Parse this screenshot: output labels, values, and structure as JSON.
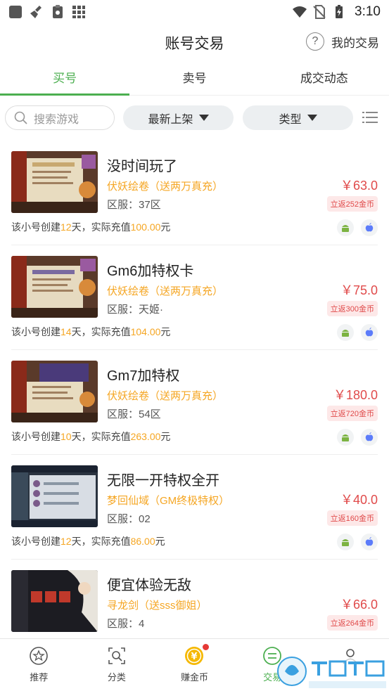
{
  "status_bar": {
    "time": "3:10"
  },
  "header": {
    "title": "账号交易",
    "my_trade": "我的交易"
  },
  "tabs": [
    {
      "label": "买号",
      "active": true
    },
    {
      "label": "卖号",
      "active": false
    },
    {
      "label": "成交动态",
      "active": false
    }
  ],
  "filters": {
    "search_placeholder": "搜索游戏",
    "latest_label": "最新上架",
    "type_label": "类型"
  },
  "listings": [
    {
      "title": "没时间玩了",
      "game": "伏妖绘卷（送两万真充）",
      "server": "区服：37区",
      "price": "￥63.0",
      "rebate": "立返252金币",
      "info_prefix": "该小号创建",
      "days": "12",
      "info_mid": "天，实际充值",
      "recharge": "100.00",
      "info_suffix": "元"
    },
    {
      "title": "Gm6加特权卡",
      "game": "伏妖绘卷（送两万真充）",
      "server": "区服：天姬·",
      "price": "￥75.0",
      "rebate": "立返300金币",
      "info_prefix": "该小号创建",
      "days": "14",
      "info_mid": "天，实际充值",
      "recharge": "104.00",
      "info_suffix": "元"
    },
    {
      "title": "Gm7加特权",
      "game": "伏妖绘卷（送两万真充）",
      "server": "区服：54区",
      "price": "￥180.0",
      "rebate": "立返720金币",
      "info_prefix": "该小号创建",
      "days": "10",
      "info_mid": "天，实际充值",
      "recharge": "263.00",
      "info_suffix": "元"
    },
    {
      "title": "无限一开特权全开",
      "game": "梦回仙域（GM终极特权）",
      "server": "区服：02",
      "price": "￥40.0",
      "rebate": "立返160金币",
      "info_prefix": "该小号创建",
      "days": "12",
      "info_mid": "天，实际充值",
      "recharge": "86.00",
      "info_suffix": "元"
    },
    {
      "title": "便宜体验无敌",
      "game": "寻龙剑（送sss御姐）",
      "server": "区服：4",
      "price": "￥66.0",
      "rebate": "立返264金币"
    }
  ],
  "bottom_nav": [
    {
      "label": "推荐",
      "icon": "star-circle-icon"
    },
    {
      "label": "分类",
      "icon": "search-box-icon"
    },
    {
      "label": "赚金币",
      "icon": "coin-icon"
    },
    {
      "label": "交易",
      "icon": "trade-icon"
    }
  ],
  "colors": {
    "accent": "#4caf50",
    "price": "#e04a4a",
    "highlight": "#f5a623"
  }
}
